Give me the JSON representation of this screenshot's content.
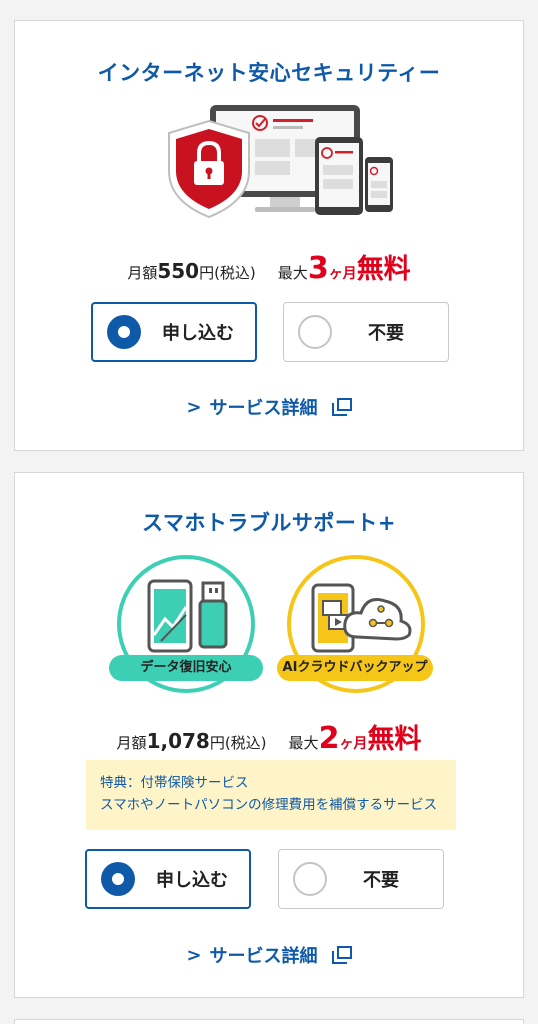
{
  "security": {
    "title": "インターネット安心セキュリティー",
    "price_prefix": "月額",
    "price_amount": "550",
    "price_suffix": "円(税込)",
    "promo_prefix": "最大",
    "promo_number": "3",
    "promo_unit": "ヶ月",
    "promo_free": "無料",
    "apply_label": "申し込む",
    "decline_label": "不要",
    "selected": "apply",
    "detail_link": "サービス詳細"
  },
  "support": {
    "title": "スマホトラブルサポート+",
    "badge_left": "データ復旧安心",
    "badge_right": "AIクラウドバックアップ",
    "price_prefix": "月額",
    "price_amount": "1,078",
    "price_suffix": "円(税込)",
    "promo_prefix": "最大",
    "promo_number": "2",
    "promo_unit": "ヶ月",
    "promo_free": "無料",
    "perk_line1": "特典：付帯保険サービス",
    "perk_line2": "スマホやノートパソコンの修理費用を補償するサービス",
    "apply_label": "申し込む",
    "decline_label": "不要",
    "selected": "apply",
    "detail_link": "サービス詳細"
  },
  "colors": {
    "brand_blue": "#0f5aa8",
    "promo_red": "#e0001b",
    "teal_ring": "#3ccfb3",
    "yellow_ring": "#f5c518",
    "perk_bg": "#fff4c8"
  }
}
